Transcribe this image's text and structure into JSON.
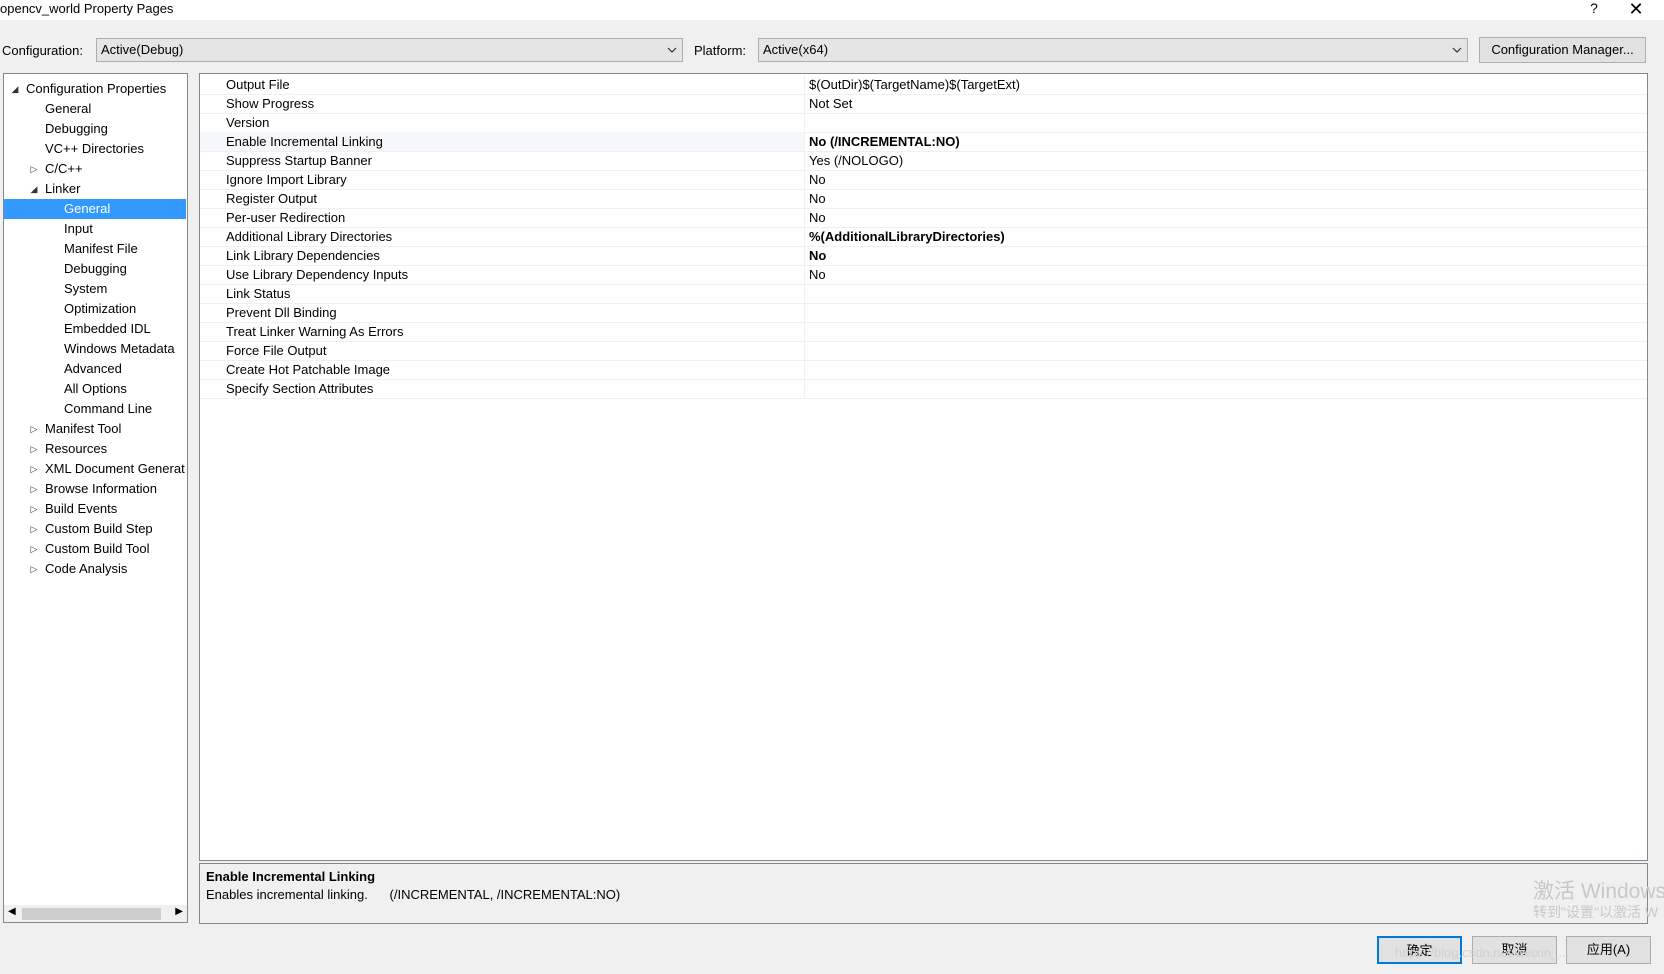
{
  "window": {
    "title": "opencv_world Property Pages",
    "help_label": "?",
    "close_label": "✕"
  },
  "config": {
    "configuration_label": "Configuration:",
    "configuration_value": "Active(Debug)",
    "platform_label": "Platform:",
    "platform_value": "Active(x64)",
    "manager_button": "Configuration Manager..."
  },
  "tree": {
    "items": [
      {
        "label": "Configuration Properties",
        "toggle": "◢"
      },
      {
        "label": "General",
        "toggle": ""
      },
      {
        "label": "Debugging",
        "toggle": ""
      },
      {
        "label": "VC++ Directories",
        "toggle": ""
      },
      {
        "label": "C/C++",
        "toggle": "▷"
      },
      {
        "label": "Linker",
        "toggle": "◢"
      },
      {
        "label": "General",
        "toggle": ""
      },
      {
        "label": "Input",
        "toggle": ""
      },
      {
        "label": "Manifest File",
        "toggle": ""
      },
      {
        "label": "Debugging",
        "toggle": ""
      },
      {
        "label": "System",
        "toggle": ""
      },
      {
        "label": "Optimization",
        "toggle": ""
      },
      {
        "label": "Embedded IDL",
        "toggle": ""
      },
      {
        "label": "Windows Metadata",
        "toggle": ""
      },
      {
        "label": "Advanced",
        "toggle": ""
      },
      {
        "label": "All Options",
        "toggle": ""
      },
      {
        "label": "Command Line",
        "toggle": ""
      },
      {
        "label": "Manifest Tool",
        "toggle": "▷"
      },
      {
        "label": "Resources",
        "toggle": "▷"
      },
      {
        "label": "XML Document Generat",
        "toggle": "▷"
      },
      {
        "label": "Browse Information",
        "toggle": "▷"
      },
      {
        "label": "Build Events",
        "toggle": "▷"
      },
      {
        "label": "Custom Build Step",
        "toggle": "▷"
      },
      {
        "label": "Custom Build Tool",
        "toggle": "▷"
      },
      {
        "label": "Code Analysis",
        "toggle": "▷"
      }
    ],
    "selected_index": 6
  },
  "properties": [
    {
      "name": "Output File",
      "value": "$(OutDir)$(TargetName)$(TargetExt)",
      "bold": false
    },
    {
      "name": "Show Progress",
      "value": "Not Set",
      "bold": false
    },
    {
      "name": "Version",
      "value": "",
      "bold": false
    },
    {
      "name": "Enable Incremental Linking",
      "value": "No (/INCREMENTAL:NO)",
      "bold": true
    },
    {
      "name": "Suppress Startup Banner",
      "value": "Yes (/NOLOGO)",
      "bold": false
    },
    {
      "name": "Ignore Import Library",
      "value": "No",
      "bold": false
    },
    {
      "name": "Register Output",
      "value": "No",
      "bold": false
    },
    {
      "name": "Per-user Redirection",
      "value": "No",
      "bold": false
    },
    {
      "name": "Additional Library Directories",
      "value": "%(AdditionalLibraryDirectories)",
      "bold": true
    },
    {
      "name": "Link Library Dependencies",
      "value": "No",
      "bold": true
    },
    {
      "name": "Use Library Dependency Inputs",
      "value": "No",
      "bold": false
    },
    {
      "name": "Link Status",
      "value": "",
      "bold": false
    },
    {
      "name": "Prevent Dll Binding",
      "value": "",
      "bold": false
    },
    {
      "name": "Treat Linker Warning As Errors",
      "value": "",
      "bold": false
    },
    {
      "name": "Force File Output",
      "value": "",
      "bold": false
    },
    {
      "name": "Create Hot Patchable Image",
      "value": "",
      "bold": false
    },
    {
      "name": "Specify Section Attributes",
      "value": "",
      "bold": false
    }
  ],
  "selected_property_index": 3,
  "description": {
    "title": "Enable Incremental Linking",
    "text": "Enables incremental linking.      (/INCREMENTAL, /INCREMENTAL:NO)"
  },
  "buttons": {
    "ok": "确定",
    "cancel": "取消",
    "apply": "应用(A)"
  },
  "watermark": {
    "line1": "激活 Windows",
    "line2": "转到\"设置\"以激活 W",
    "url": "https://blog.csdn.net/weixin_..."
  },
  "colors": {
    "selection": "#3399ff",
    "window_bg": "#f0f0f0",
    "panel_bg": "#ffffff"
  }
}
